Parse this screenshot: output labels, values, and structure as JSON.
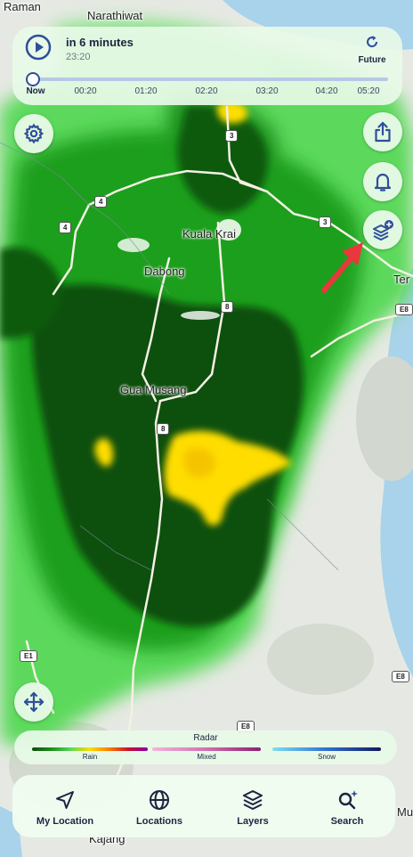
{
  "colors": {
    "accent": "#2f4f9a",
    "panel": "#e8fae8",
    "text": "#1c2440",
    "rain_heavy": "#0d4d0d",
    "rain_moderate": "#1a8f1a",
    "rain_light": "#58d858",
    "rain_intense": "#ffdd00",
    "arrow": "#e8383d"
  },
  "map": {
    "place_labels": [
      {
        "id": "raman",
        "text": "Raman"
      },
      {
        "id": "narathiwat",
        "text": "Narathiwat"
      },
      {
        "id": "kuala-krai",
        "text": "Kuala Krai"
      },
      {
        "id": "dabong",
        "text": "Dabong"
      },
      {
        "id": "gua-musang",
        "text": "Gua Musang"
      },
      {
        "id": "ter",
        "text": "Ter"
      },
      {
        "id": "kajang",
        "text": "Kajang"
      },
      {
        "id": "mu",
        "text": "Mu"
      }
    ],
    "road_shields": [
      "3",
      "4",
      "4",
      "3",
      "8",
      "8",
      "E8",
      "E1",
      "E8",
      "E8"
    ]
  },
  "timeline": {
    "title": "in 6 minutes",
    "time": "23:20",
    "future_label": "Future",
    "ticks": [
      "Now",
      "00:20",
      "01:20",
      "02:20",
      "03:20",
      "04:20",
      "05:20"
    ],
    "progress": 0
  },
  "buttons": {
    "settings": "gear-icon",
    "share": "share-icon",
    "alerts": "bell-icon",
    "layers_add": "layers-plus-icon",
    "move": "move-arrows-icon"
  },
  "legend": {
    "title": "Radar",
    "items": [
      {
        "label": "Rain"
      },
      {
        "label": "Mixed"
      },
      {
        "label": "Snow"
      }
    ]
  },
  "tabbar": {
    "items": [
      {
        "label": "My Location",
        "icon": "navigation-arrow-icon"
      },
      {
        "label": "Locations",
        "icon": "globe-icon"
      },
      {
        "label": "Layers",
        "icon": "layers-icon"
      },
      {
        "label": "Search",
        "icon": "search-sparkle-icon"
      }
    ]
  }
}
